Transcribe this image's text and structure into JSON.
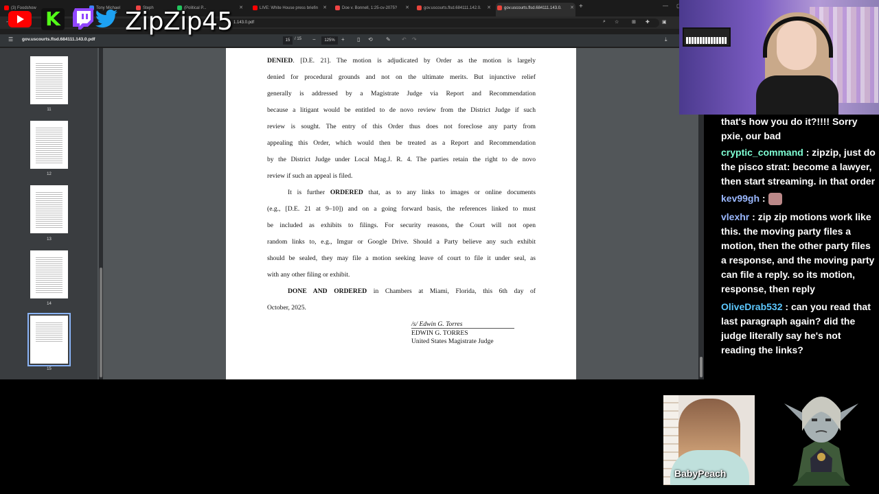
{
  "browser": {
    "tabs": [
      {
        "label": "(3) Foodshow",
        "color": "#ff0000"
      },
      {
        "label": "Tony Michael",
        "color": "#3b82f6"
      },
      {
        "label": "Steph",
        "color": "#ef4444"
      },
      {
        "label": "(Political P...",
        "color": "#22c55e"
      },
      {
        "label": "LIVE: White House press briefin",
        "color": "#ff0000"
      },
      {
        "label": "Doe v. Bonnell, 1:25-cv-2075?",
        "color": "#ef4444"
      },
      {
        "label": "gov.uscourts.flsd.684111.142.0.",
        "color": "#e8453c"
      },
      {
        "label": "gov.uscourts.flsd.684111.143.0.",
        "color": "#e8453c"
      }
    ],
    "url": "1.143.0.pdf",
    "pdf": {
      "title": "gov.uscourts.flsd.684111.143.0.pdf",
      "current_page": "15",
      "total_pages": "/ 15",
      "zoom": "125%",
      "thumbnails": [
        {
          "num": "11"
        },
        {
          "num": "12"
        },
        {
          "num": "13"
        },
        {
          "num": "14"
        },
        {
          "num": "15"
        }
      ],
      "lines": [
        {
          "pre": "",
          "bold": "DENIED",
          "text": ".  [D.E. 21].  The motion is adjudicated by Order as the motion is largely"
        },
        {
          "pre": "",
          "bold": "",
          "text": "denied for procedural grounds and not on the ultimate merits.  But injunctive relief"
        },
        {
          "pre": "",
          "bold": "",
          "text": "generally is addressed by a Magistrate Judge via Report and Recommendation"
        },
        {
          "pre": "",
          "bold": "",
          "text": "because a litigant would be entitled to de novo review from the District Judge if such"
        },
        {
          "pre": "",
          "bold": "",
          "text": "review is sought.  The entry of this Order thus does not foreclose any party from"
        },
        {
          "pre": "",
          "bold": "",
          "text": "appealing this Order, which would then be treated as a Report and Recommendation"
        },
        {
          "pre": "",
          "bold": "",
          "text": "by the District Judge under Local Mag.J. R. 4.  The parties retain the right to de novo"
        },
        {
          "pre": "",
          "bold": "",
          "text": "review if such an appeal is filed."
        },
        {
          "pre": "It is further ",
          "bold": "ORDERED",
          "text": " that, as to any links to images or online documents"
        },
        {
          "pre": "",
          "bold": "",
          "text": "(e.g., [D.E. 21 at 9–10]) and on a going forward basis, the references linked to must"
        },
        {
          "pre": "",
          "bold": "",
          "text": "be included as exhibits to filings.  For security reasons, the Court will not open"
        },
        {
          "pre": "",
          "bold": "",
          "text": "random links to, e.g., Imgur or Google Drive.  Should a Party believe any such exhibit"
        },
        {
          "pre": "",
          "bold": "",
          "text": "should be sealed, they may file a motion seeking leave of court to file it under seal, as"
        },
        {
          "pre": "",
          "bold": "",
          "text": "with any other filing or exhibit."
        },
        {
          "pre": "",
          "bold": "DONE AND ORDERED",
          "text": " in Chambers at Miami, Florida, this 6th day of"
        },
        {
          "pre": "",
          "bold": "",
          "text": "October, 2025."
        }
      ],
      "signature": {
        "sig": "/s/ Edwin G. Torres",
        "name": "EDWIN G. TORRES",
        "title": "United States Magistrate Judge"
      }
    }
  },
  "overlay": {
    "handle": "ZipZip45",
    "social_icons": [
      "youtube-icon",
      "kick-icon",
      "twitch-icon",
      "twitter-icon"
    ],
    "kick_letter": "K"
  },
  "chat": {
    "messages": [
      {
        "user": "",
        "user_color": "#ffffff",
        "text": "that's how you do it?!!!! Sorry pxie, our bad"
      },
      {
        "user": "cryptic_command",
        "user_color": "#7fffd4",
        "text": " : zipzip, just do the pisco strat: become a lawyer, then start streaming. in that order"
      },
      {
        "user": "kev99gh",
        "user_color": "#9ab8ff",
        "text": " : "
      },
      {
        "user": "vlexhr",
        "user_color": "#9ab8ff",
        "text": " : zip zip motions work like this. the moving party files a motion, then the other party files a response, and the moving party can file a reply. so its motion, response, then reply"
      },
      {
        "user": "OliveDrab532",
        "user_color": "#5dc8ff",
        "text": " : can you read that last paragraph again? did the judge literally say he's not reading the links?"
      }
    ]
  },
  "cam2": {
    "label": "BabyPeach"
  }
}
